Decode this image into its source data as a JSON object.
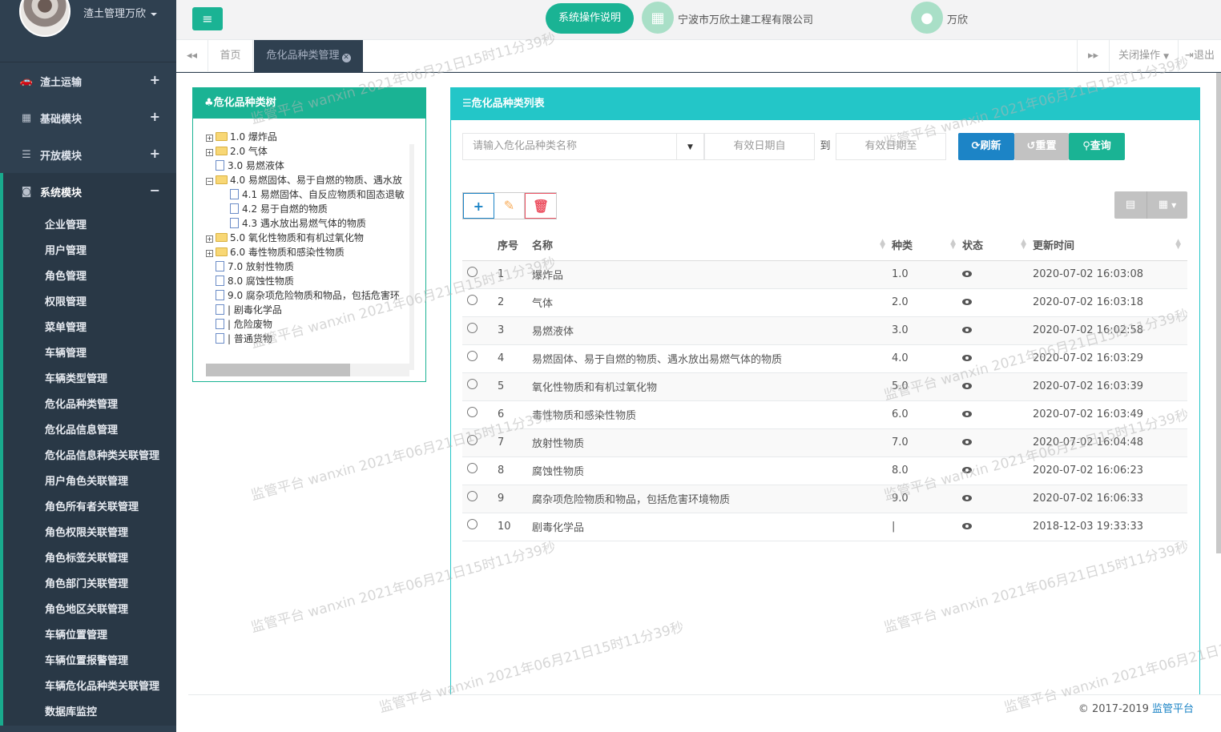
{
  "sidebar": {
    "user_role": "渣土管理万欣",
    "modules": [
      {
        "icon": "car-icon",
        "glyph": "🚗",
        "label": "渣土运输",
        "expand": "+"
      },
      {
        "icon": "qrcode-icon",
        "glyph": "▦",
        "label": "基础模块",
        "expand": "+"
      },
      {
        "icon": "bars-icon",
        "glyph": "☰",
        "label": "开放模块",
        "expand": "+"
      },
      {
        "icon": "square-arrow-icon",
        "glyph": "◙",
        "label": "系统模块",
        "expand": "−"
      }
    ],
    "sub_items": [
      "企业管理",
      "用户管理",
      "角色管理",
      "权限管理",
      "菜单管理",
      "车辆管理",
      "车辆类型管理",
      "危化品种类管理",
      "危化品信息管理",
      "危化品信息种类关联管理",
      "用户角色关联管理",
      "角色所有者关联管理",
      "角色权限关联管理",
      "角色标签关联管理",
      "角色部门关联管理",
      "角色地区关联管理",
      "车辆位置管理",
      "车辆位置报警管理",
      "车辆危化品种类关联管理",
      "数据库监控"
    ]
  },
  "topbar": {
    "help_label": "系统操作说明",
    "company": "宁波市万欣土建工程有限公司",
    "user": "万欣"
  },
  "tabs": {
    "home": "首页",
    "current": "危化品种类管理",
    "close_ops": "关闭操作",
    "logout": "退出"
  },
  "tree": {
    "title": "危化品种类树",
    "nodes": [
      {
        "level": 0,
        "toggle": "+",
        "type": "folder",
        "label": "1.0 爆炸品"
      },
      {
        "level": 0,
        "toggle": "+",
        "type": "folder",
        "label": "2.0 气体"
      },
      {
        "level": 0,
        "toggle": "",
        "type": "file",
        "label": "3.0 易燃液体"
      },
      {
        "level": 0,
        "toggle": "−",
        "type": "folder",
        "label": "4.0 易燃固体、易于自燃的物质、遇水放"
      },
      {
        "level": 1,
        "toggle": "",
        "type": "file",
        "label": "4.1 易燃固体、自反应物质和固态退敏"
      },
      {
        "level": 1,
        "toggle": "",
        "type": "file",
        "label": "4.2 易于自燃的物质"
      },
      {
        "level": 1,
        "toggle": "",
        "type": "file",
        "label": "4.3 遇水放出易燃气体的物质"
      },
      {
        "level": 0,
        "toggle": "+",
        "type": "folder",
        "label": "5.0 氧化性物质和有机过氧化物"
      },
      {
        "level": 0,
        "toggle": "+",
        "type": "folder",
        "label": "6.0 毒性物质和感染性物质"
      },
      {
        "level": 0,
        "toggle": "",
        "type": "file",
        "label": "7.0 放射性物质"
      },
      {
        "level": 0,
        "toggle": "",
        "type": "file",
        "label": "8.0 腐蚀性物质"
      },
      {
        "level": 0,
        "toggle": "",
        "type": "file",
        "label": "9.0 腐杂项危险物质和物品，包括危害环"
      },
      {
        "level": 0,
        "toggle": "",
        "type": "file",
        "label": "| 剧毒化学品"
      },
      {
        "level": 0,
        "toggle": "",
        "type": "file",
        "label": "| 危险废物"
      },
      {
        "level": 0,
        "toggle": "",
        "type": "file",
        "label": "| 普通货物"
      }
    ]
  },
  "list": {
    "title": "危化品种类列表",
    "search_placeholder": "请输入危化品种类名称",
    "date_from": "有效日期自",
    "date_to_label": "到",
    "date_to": "有效日期至",
    "refresh": "刷新",
    "reset": "重置",
    "query": "查询",
    "columns": [
      "序号",
      "名称",
      "种类",
      "状态",
      "更新时间"
    ],
    "rows": [
      {
        "no": "1",
        "name": "爆炸品",
        "kind": "1.0",
        "time": "2020-07-02 16:03:08"
      },
      {
        "no": "2",
        "name": "气体",
        "kind": "2.0",
        "time": "2020-07-02 16:03:18"
      },
      {
        "no": "3",
        "name": "易燃液体",
        "kind": "3.0",
        "time": "2020-07-02 16:02:58"
      },
      {
        "no": "4",
        "name": "易燃固体、易于自燃的物质、遇水放出易燃气体的物质",
        "kind": "4.0",
        "time": "2020-07-02 16:03:29"
      },
      {
        "no": "5",
        "name": "氧化性物质和有机过氧化物",
        "kind": "5.0",
        "time": "2020-07-02 16:03:39"
      },
      {
        "no": "6",
        "name": "毒性物质和感染性物质",
        "kind": "6.0",
        "time": "2020-07-02 16:03:49"
      },
      {
        "no": "7",
        "name": "放射性物质",
        "kind": "7.0",
        "time": "2020-07-02 16:04:48"
      },
      {
        "no": "8",
        "name": "腐蚀性物质",
        "kind": "8.0",
        "time": "2020-07-02 16:06:23"
      },
      {
        "no": "9",
        "name": "腐杂项危险物质和物品，包括危害环境物质",
        "kind": "9.0",
        "time": "2020-07-02 16:06:33"
      },
      {
        "no": "10",
        "name": "剧毒化学品",
        "kind": "|",
        "time": "2018-12-03 19:33:33"
      }
    ]
  },
  "footer": {
    "copyright": "© 2017-2019 ",
    "brand": "监管平台"
  },
  "watermark": "监管平台 wanxin 2021年06月21日15时11分39秒"
}
